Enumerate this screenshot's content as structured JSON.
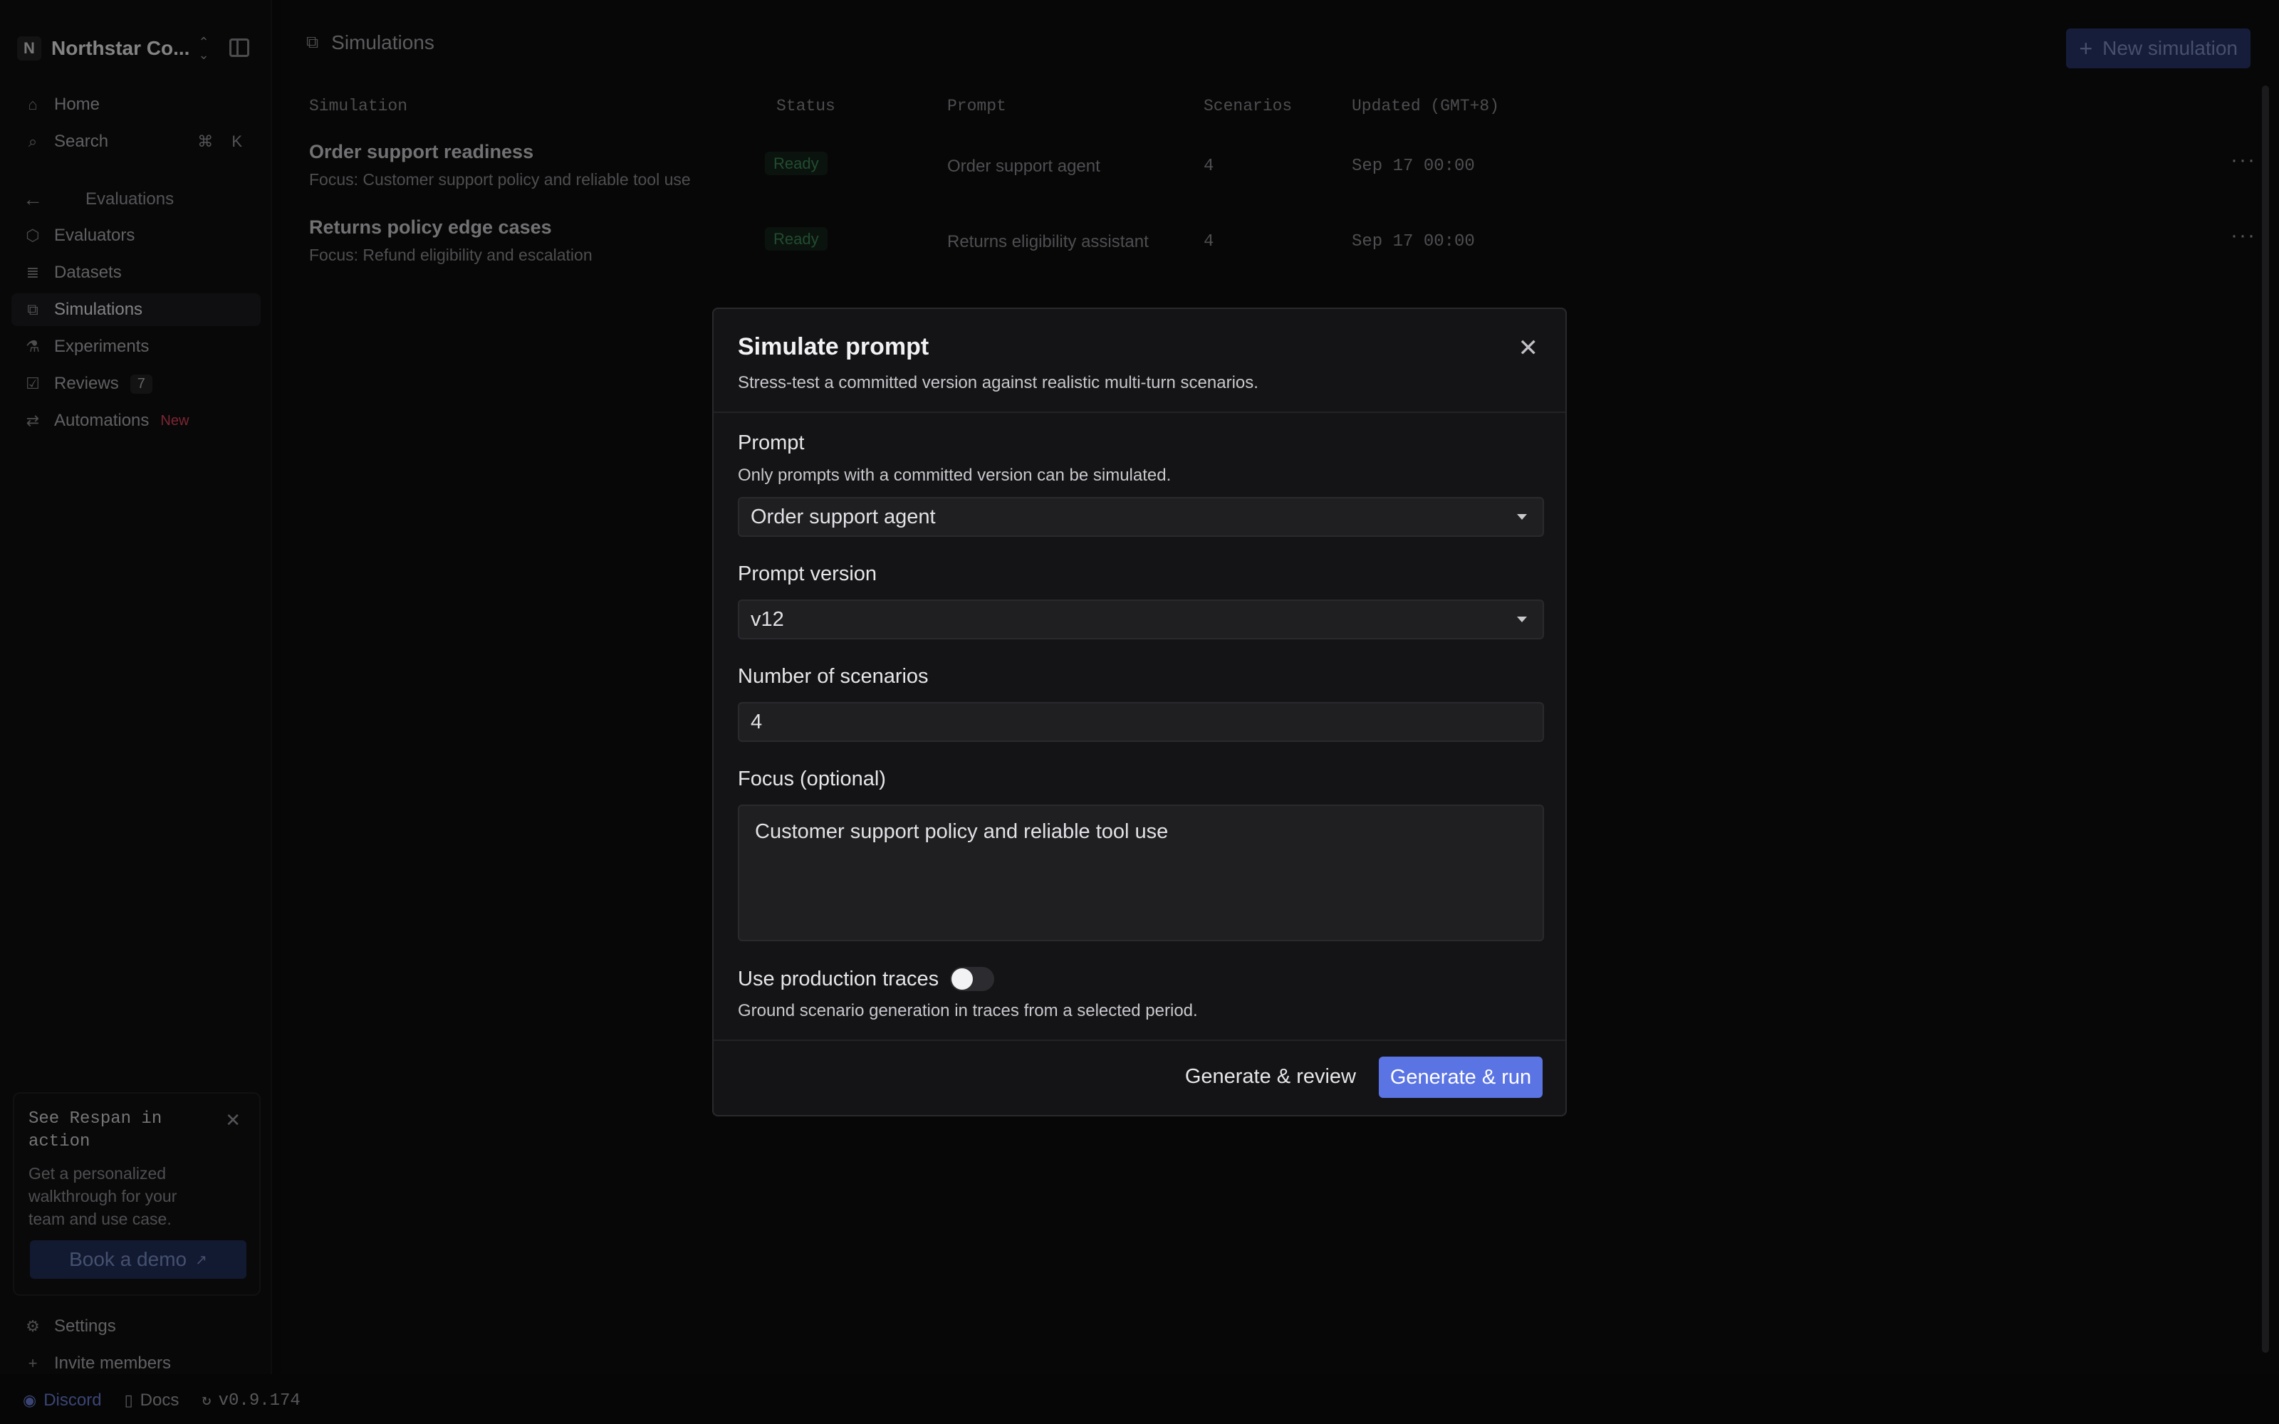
{
  "workspace": {
    "initial": "N",
    "name": "Northstar Co..."
  },
  "sidebar": {
    "home": "Home",
    "search": "Search",
    "search_shortcut": "⌘ K",
    "section": "Evaluations",
    "items": [
      {
        "label": "Evaluators"
      },
      {
        "label": "Datasets"
      },
      {
        "label": "Simulations"
      },
      {
        "label": "Experiments"
      },
      {
        "label": "Reviews",
        "badge": "7"
      },
      {
        "label": "Automations",
        "tag": "New"
      }
    ],
    "promo": {
      "title": "See Respan in action",
      "text": "Get a personalized walkthrough for your team and use case.",
      "button": "Book a demo"
    },
    "settings": "Settings",
    "invite": "Invite members",
    "footer": {
      "discord": "Discord",
      "docs": "Docs",
      "version": "v0.9.174"
    }
  },
  "page": {
    "title": "Simulations",
    "new_button": "New simulation",
    "columns": [
      "Simulation",
      "Status",
      "Prompt",
      "Scenarios",
      "Updated (GMT+8)"
    ],
    "rows": [
      {
        "name": "Order support readiness",
        "focus": "Focus: Customer support policy and reliable tool use",
        "status": "Ready",
        "prompt": "Order support agent",
        "scenarios": "4",
        "updated": "Sep 17 00:00"
      },
      {
        "name": "Returns policy edge cases",
        "focus": "Focus: Refund eligibility and escalation",
        "status": "Ready",
        "prompt": "Returns eligibility assistant",
        "scenarios": "4",
        "updated": "Sep 17 00:00"
      }
    ]
  },
  "modal": {
    "title": "Simulate prompt",
    "subtitle": "Stress-test a committed version against realistic multi-turn scenarios.",
    "prompt_label": "Prompt",
    "prompt_help": "Only prompts with a committed version can be simulated.",
    "prompt_value": "Order support agent",
    "version_label": "Prompt version",
    "version_value": "v12",
    "scenarios_label": "Number of scenarios",
    "scenarios_value": "4",
    "focus_label": "Focus (optional)",
    "focus_value": "Customer support policy and reliable tool use",
    "traces_label": "Use production traces",
    "traces_help": "Ground scenario generation in traces from a selected period.",
    "traces_enabled": false,
    "review_button": "Generate & review",
    "run_button": "Generate & run"
  },
  "colors": {
    "accent": "#5b74e4",
    "status_ready": "#3d8a56",
    "new_tag": "#e0455d"
  }
}
